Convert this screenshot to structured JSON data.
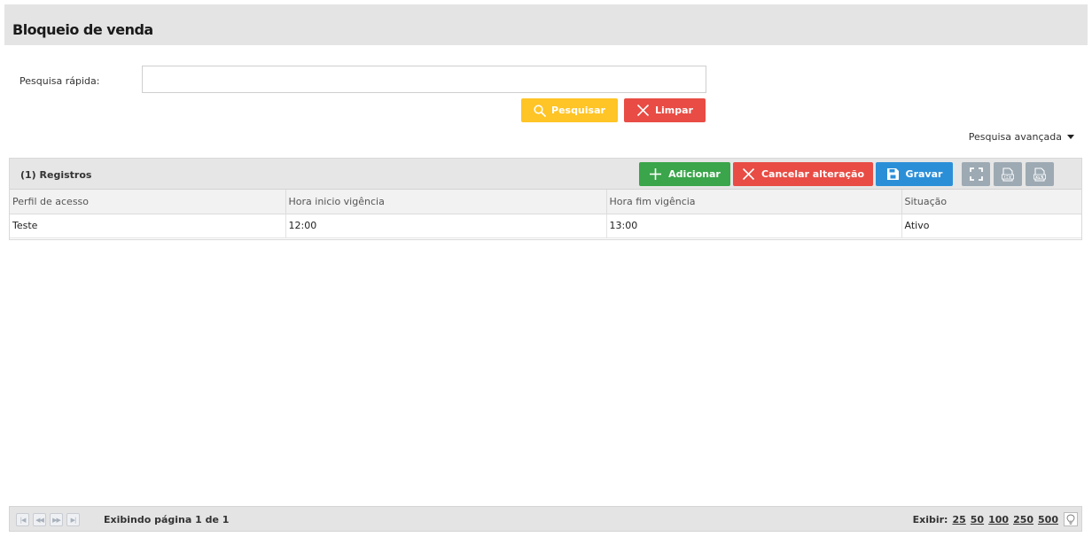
{
  "page": {
    "title": "Bloqueio de venda"
  },
  "search": {
    "label": "Pesquisa rápida:",
    "value": "",
    "placeholder": "",
    "search_button": "Pesquisar",
    "clear_button": "Limpar",
    "advanced_label": "Pesquisa avançada"
  },
  "grid": {
    "records_label": "(1) Registros",
    "toolbar": {
      "add": "Adicionar",
      "cancel": "Cancelar alteração",
      "save": "Gravar",
      "icons": [
        "fullscreen-icon",
        "csv-export-icon",
        "xls-export-icon"
      ]
    },
    "columns": [
      "Perfil de acesso",
      "Hora inicio vigência",
      "Hora fim vigência",
      "Situação"
    ],
    "rows": [
      [
        "Teste",
        "12:00",
        "13:00",
        "Ativo"
      ]
    ]
  },
  "footer": {
    "page_info": "Exibindo página 1 de 1",
    "show_label": "Exibir:",
    "page_sizes": [
      "25",
      "50",
      "100",
      "250",
      "500"
    ]
  },
  "colors": {
    "search": "#ffc425",
    "danger": "#e84c44",
    "success": "#3aa54a",
    "primary": "#2b8fd8",
    "neutral": "#9daab3"
  }
}
